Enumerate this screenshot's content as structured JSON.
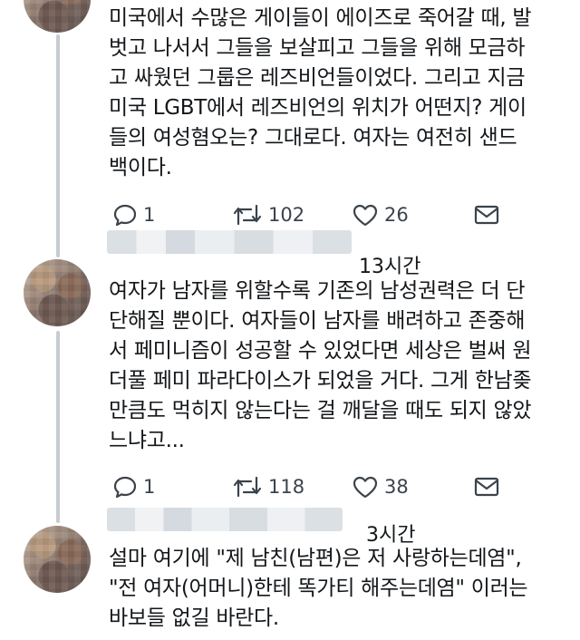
{
  "tweets": [
    {
      "text": "미국에서 수많은 게이들이 에이즈로 죽어갈 때, 발\n벗고 나서서 그들을 보살피고 그들을 위해 모금하\n고 싸웠던 그룹은 레즈비언들이었다. 그리고 지금\n미국 LGBT에서 레즈비언의 위치가 어떤지? 게이\n들의 여성혐오는? 그대로다. 여자는 여전히 샌드\n백이다.",
      "actions": {
        "reply": "1",
        "retweet": "102",
        "like": "26"
      }
    },
    {
      "time": "13시간",
      "text": "여자가 남자를 위할수록 기존의 남성권력은 더 단\n단해질 뿐이다. 여자들이 남자를 배려하고 존중해\n서 페미니즘이 성공할 수 있었다면 세상은 벌써 원\n더풀 페미 파라다이스가 되었을 거다. 그게 한남좆\n만큼도 먹히지 않는다는 걸 깨달을 때도 되지 않았\n느냐고...",
      "actions": {
        "reply": "1",
        "retweet": "118",
        "like": "38"
      }
    },
    {
      "time": "3시간",
      "text": "설마 여기에 \"제 남친(남편)은 저 사랑하는데염\",\n\"전 여자(어머니)한테 똑가티 해주는데염\" 이러는\n바보들 없길 바란다."
    }
  ],
  "icons": [
    "reply-icon",
    "retweet-icon",
    "like-icon",
    "dm-icon"
  ],
  "colors": {
    "icon": "#3b434b",
    "thread_line": "#c5ccd3",
    "text": "#14171a"
  }
}
